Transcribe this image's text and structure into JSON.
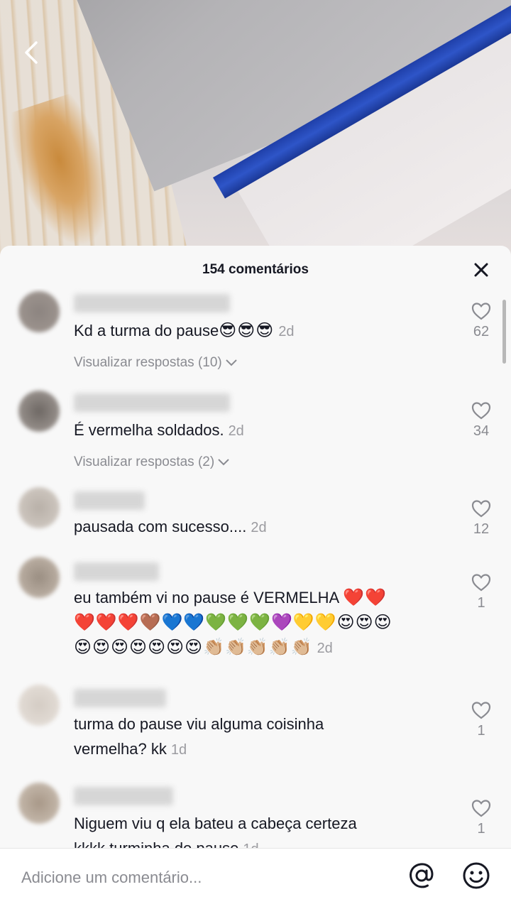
{
  "header": {
    "title": "154 comentários"
  },
  "comments": [
    {
      "text": "Kd a turma do pause",
      "emoji": "😎😎😎",
      "time": "2d",
      "likes": "62",
      "replies": "Visualizar respostas (10)"
    },
    {
      "text": "É vermelha soldados.",
      "time": "2d",
      "likes": "34",
      "replies": "Visualizar respostas (2)"
    },
    {
      "text": "pausada com sucesso....",
      "time": "2d",
      "likes": "12"
    },
    {
      "text": "eu também vi no pause é VERMELHA",
      "emoji_line1": "❤️❤️",
      "emoji_line2": "❤️❤️❤️🤎💙💙💚💚💚💜💛💛😍😍😍",
      "emoji_line3": "😍😍😍😍😍😍😍👏🏼👏🏼👏🏼👏🏼👏🏼",
      "time": "2d",
      "likes": "1"
    },
    {
      "text_line1": "turma do pause viu alguma coisinha",
      "text_line2": "vermelha? kk",
      "time": "1d",
      "likes": "1"
    },
    {
      "text_line1": "Niguem viu q ela bateu a cabeça certeza",
      "text_line2": "kkkk turminha do pause",
      "time": "1d",
      "likes": "1"
    }
  ],
  "input": {
    "placeholder": "Adicione um comentário..."
  },
  "icons": {
    "back": "chevron-left-icon",
    "close": "close-icon",
    "like": "heart-outline-icon",
    "replies": "chevron-down-icon",
    "mention": "at-icon",
    "emoji": "smiley-icon"
  }
}
